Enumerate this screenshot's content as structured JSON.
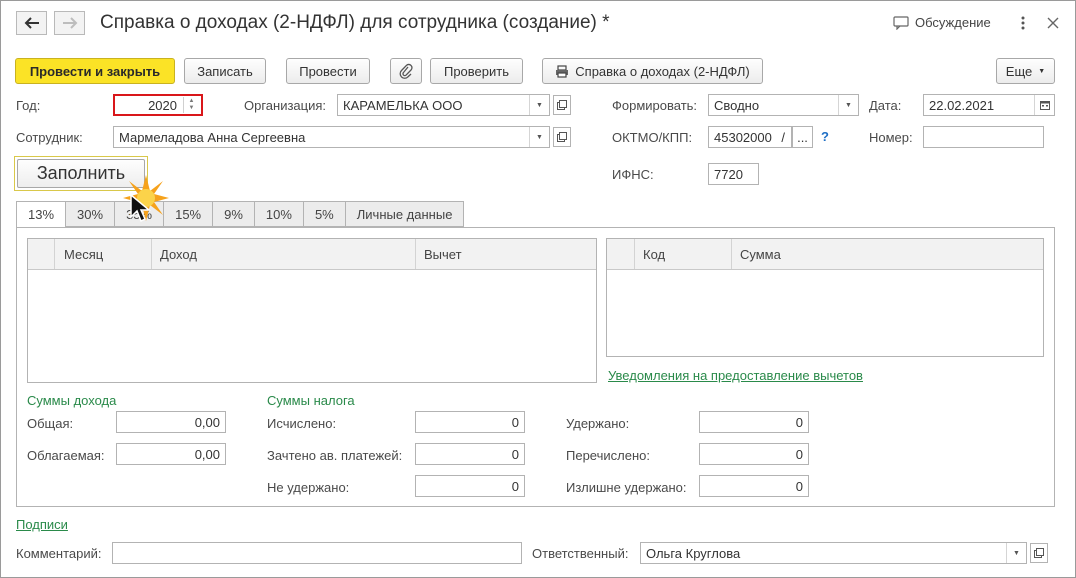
{
  "window": {
    "title": "Справка о доходах (2-НДФЛ) для сотрудника (создание) *",
    "discussion_label": "Обсуждение"
  },
  "toolbar": {
    "post_close_label": "Провести и закрыть",
    "save_label": "Записать",
    "post_label": "Провести",
    "check_label": "Проверить",
    "print_label": "Справка о доходах (2-НДФЛ)",
    "more_label": "Еще"
  },
  "form": {
    "year_label": "Год:",
    "year_value": "2020",
    "org_label": "Организация:",
    "org_value": "КАРАМЕЛЬКА ООО",
    "form_label": "Формировать:",
    "form_value": "Сводно",
    "date_label": "Дата:",
    "date_value": "22.02.2021",
    "employee_label": "Сотрудник:",
    "employee_value": "Мармеладова Анна Сергеевна",
    "oktmo_label": "ОКТМО/КПП:",
    "oktmo_value": "45302000",
    "oktmo_sep": "/",
    "oktmo_more": "...",
    "help_mark": "?",
    "number_label": "Номер:",
    "number_value": "",
    "ifns_label": "ИФНС:",
    "ifns_value": "7720",
    "fill_label": "Заполнить"
  },
  "tabs": [
    "13%",
    "30%",
    "35%",
    "15%",
    "9%",
    "10%",
    "5%",
    "Личные данные"
  ],
  "income_table": {
    "columns": [
      "Месяц",
      "Доход",
      "Вычет"
    ]
  },
  "deduction_table": {
    "columns": [
      "Код",
      "Сумма"
    ]
  },
  "notifications_link": "Уведомления на предоставление вычетов",
  "income_sums": {
    "header": "Суммы дохода",
    "total_label": "Общая:",
    "total_value": "0,00",
    "taxable_label": "Облагаемая:",
    "taxable_value": "0,00"
  },
  "tax_sums": {
    "header": "Суммы налога",
    "calculated_label": "Исчислено:",
    "calculated_value": "0",
    "credited_label": "Зачтено ав. платежей:",
    "credited_value": "0",
    "not_withheld_label": "Не удержано:",
    "not_withheld_value": "0",
    "withheld_label": "Удержано:",
    "withheld_value": "0",
    "transferred_label": "Перечислено:",
    "transferred_value": "0",
    "overwithheld_label": "Излишне удержано:",
    "overwithheld_value": "0"
  },
  "footer": {
    "signatures_link": "Подписи",
    "comment_label": "Комментарий:",
    "comment_value": "",
    "responsible_label": "Ответственный:",
    "responsible_value": "Ольга Круглова"
  },
  "colors": {
    "primary_button": "#fbe326",
    "link_green": "#2a8a4a",
    "highlight_red": "#d9161a"
  }
}
